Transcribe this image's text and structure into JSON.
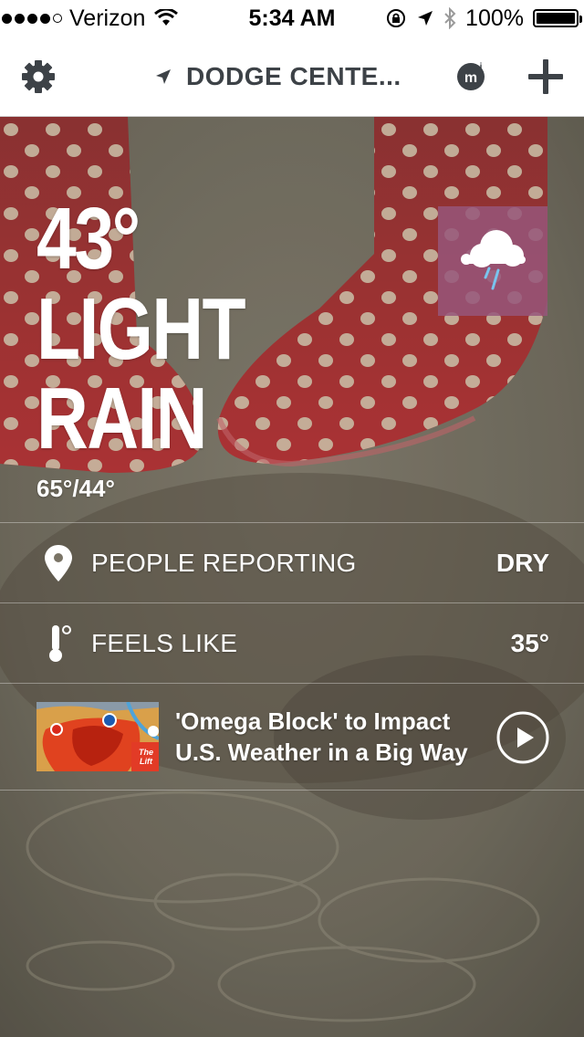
{
  "status_bar": {
    "carrier": "Verizon",
    "time": "5:34 AM",
    "battery": "100%",
    "icons": [
      "signal-dots-icon",
      "wifi-icon",
      "rotation-lock-icon",
      "location-icon",
      "bluetooth-icon",
      "battery-icon"
    ]
  },
  "nav": {
    "location": "DODGE CENTE...",
    "icons": [
      "gear-icon",
      "location-arrow-icon",
      "mi-logo-icon",
      "plus-icon"
    ]
  },
  "current": {
    "temperature": "43°",
    "condition_line1": "LIGHT",
    "condition_line2": "RAIN",
    "hi_lo": "65°/44°",
    "condition_icon": "cloud-rain-icon",
    "icon_box_color": "#97567a"
  },
  "rows": [
    {
      "icon": "location-pin-icon",
      "label": "PEOPLE REPORTING",
      "value": "DRY"
    },
    {
      "icon": "thermometer-icon",
      "label": "FEELS LIKE",
      "value": "35°"
    }
  ],
  "video": {
    "title_line1": "'Omega Block' to Impact",
    "title_line2": "U.S. Weather in a Big Way",
    "thumb_badge": "The Lift",
    "play_icon": "play-icon"
  }
}
